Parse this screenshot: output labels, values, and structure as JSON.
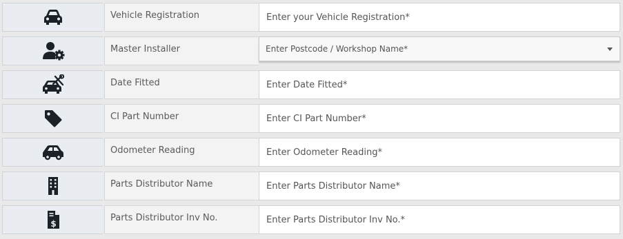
{
  "rows": [
    {
      "icon": "car-front-icon",
      "label": "Vehicle Registration",
      "placeholder": "Enter your Vehicle Registration*"
    },
    {
      "icon": "user-gear-icon",
      "label": "Master Installer",
      "placeholder": "Enter Postcode / Workshop Name*"
    },
    {
      "icon": "car-wrench-icon",
      "label": "Date Fitted",
      "placeholder": "Enter Date Fitted*"
    },
    {
      "icon": "tag-icon",
      "label": "CI Part Number",
      "placeholder": "Enter CI Part Number*"
    },
    {
      "icon": "car-side-icon",
      "label": "Odometer Reading",
      "placeholder": "Enter Odometer Reading*"
    },
    {
      "icon": "building-icon",
      "label": "Parts Distributor Name",
      "placeholder": "Enter Parts Distributor Name*"
    },
    {
      "icon": "invoice-dollar-icon",
      "label": "Parts Distributor Inv No.",
      "placeholder": "Enter Parts Distributor Inv No.*"
    }
  ],
  "colors": {
    "icon": "#1b2127",
    "icon_bg": "#e9edf2",
    "label_bg": "#f3f3f3",
    "text": "#555555"
  }
}
